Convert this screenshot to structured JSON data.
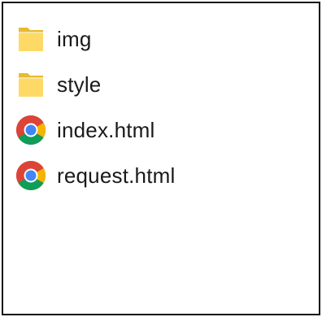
{
  "explorer": {
    "items": [
      {
        "name": "img",
        "icon": "folder-icon"
      },
      {
        "name": "style",
        "icon": "folder-icon"
      },
      {
        "name": "index.html",
        "icon": "chrome-icon"
      },
      {
        "name": "request.html",
        "icon": "chrome-icon"
      }
    ]
  },
  "colors": {
    "folder_body": "#F5C842",
    "folder_front": "#FFD966",
    "chrome_red": "#DB4437",
    "chrome_green": "#0F9D58",
    "chrome_yellow": "#F4B400",
    "chrome_blue": "#4285F4",
    "frame_border": "#111111"
  }
}
